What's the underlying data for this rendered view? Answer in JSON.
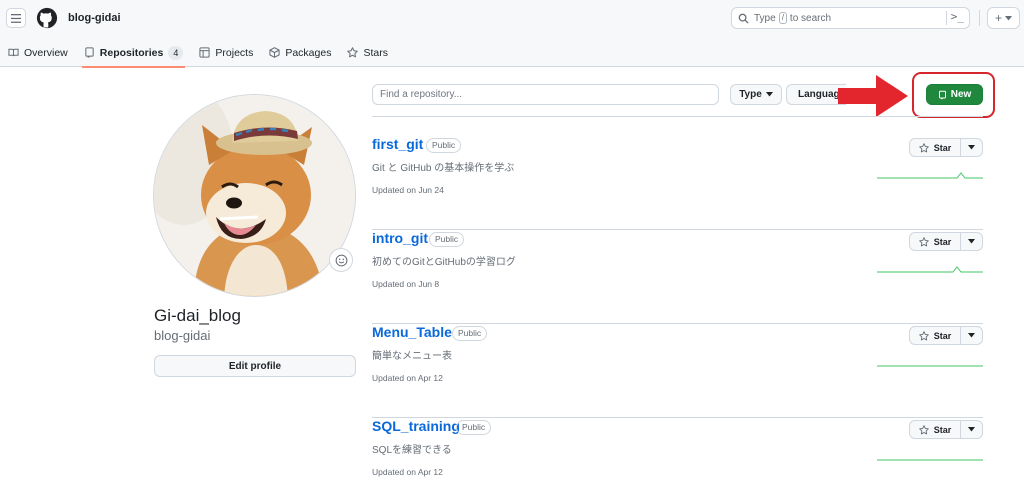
{
  "header": {
    "account": "blog-gidai",
    "search_placeholder_before": "Type",
    "search_slash": "/",
    "search_placeholder_after": "to search",
    "icons": [
      "hamburger-icon",
      "github-logo-icon",
      "search-icon",
      "command-palette-icon",
      "plus-icon",
      "triangle-down-icon"
    ]
  },
  "tabs": [
    {
      "label": "Overview",
      "icon": "book-icon"
    },
    {
      "label": "Repositories",
      "icon": "repo-icon",
      "count": "4",
      "active": true
    },
    {
      "label": "Projects",
      "icon": "table-icon"
    },
    {
      "label": "Packages",
      "icon": "package-icon"
    },
    {
      "label": "Stars",
      "icon": "star-icon"
    }
  ],
  "profile": {
    "name": "Gi-dai_blog",
    "login": "blog-gidai",
    "edit_label": "Edit profile"
  },
  "toolbar": {
    "find_placeholder": "Find a repository...",
    "type_label": "Type",
    "language_label": "Language",
    "new_label": "New"
  },
  "colors": {
    "accent_green": "#1f883d",
    "link_blue": "#0969da",
    "annotation_red": "#d6252b",
    "tab_underline": "#fd8c73"
  },
  "repos": [
    {
      "name": "first_git",
      "visibility": "Public",
      "description": "Git と GitHub の基本操作を学ぶ",
      "updated": "Updated on Jun 24",
      "star_label": "Star"
    },
    {
      "name": "intro_git",
      "visibility": "Public",
      "description": "初めてのGitとGitHubの学習ログ",
      "updated": "Updated on Jun 8",
      "star_label": "Star"
    },
    {
      "name": "Menu_Table",
      "visibility": "Public",
      "description": "簡単なメニュー表",
      "updated": "Updated on Apr 12",
      "star_label": "Star"
    },
    {
      "name": "SQL_training",
      "visibility": "Public",
      "description": "SQLを練習できる",
      "updated": "Updated on Apr 12",
      "star_label": "Star"
    }
  ]
}
